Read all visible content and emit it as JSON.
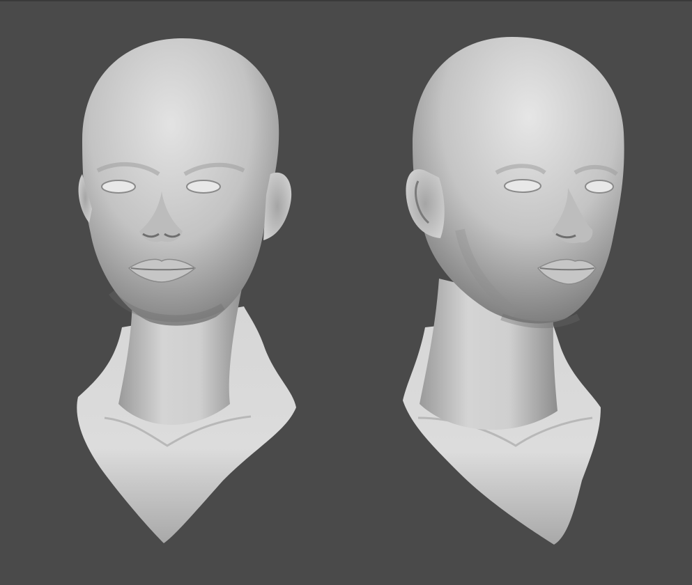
{
  "scene": {
    "background_color": "#4a4a4a",
    "clay_color": "#c8c8c8",
    "shadow_color": "#5e5e5e",
    "views": [
      {
        "name": "front",
        "icon": "sculpt-head-front"
      },
      {
        "name": "three-quarter",
        "icon": "sculpt-head-three-quarter"
      }
    ]
  }
}
